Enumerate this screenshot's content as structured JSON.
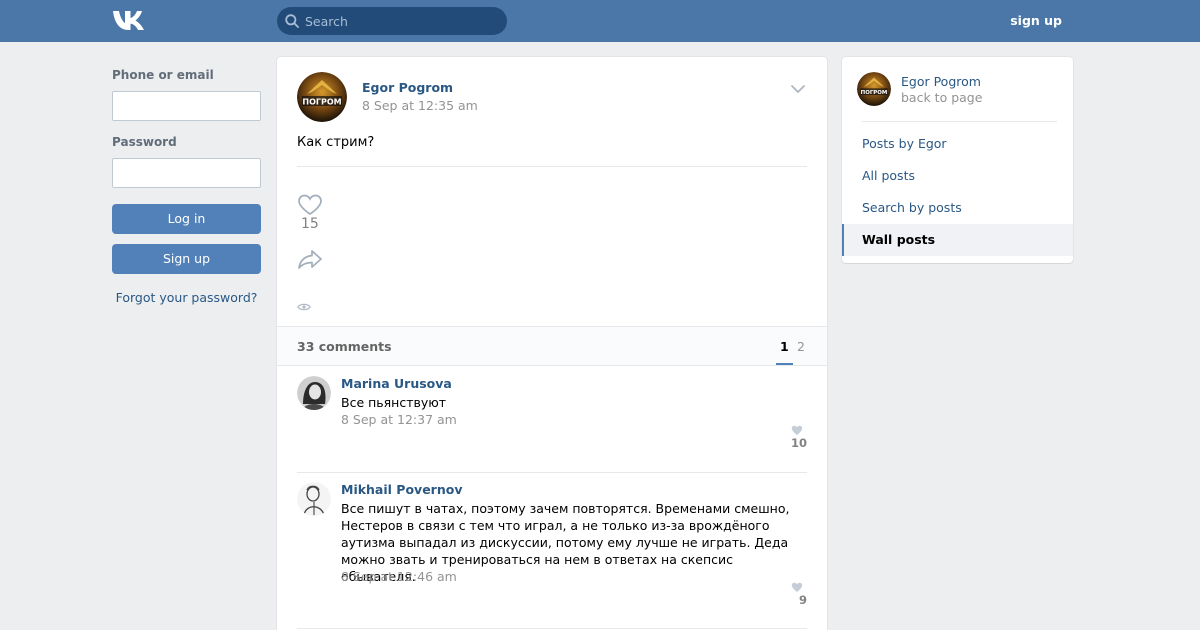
{
  "header": {
    "logo_icon": "vk-logo-icon",
    "search_placeholder": "Search",
    "signup_label": "sign up",
    "bg_color": "#4a76a8"
  },
  "login": {
    "phone_label": "Phone or email",
    "password_label": "Password",
    "login_button": "Log in",
    "signup_button": "Sign up",
    "forgot_link": "Forgot your password?"
  },
  "post": {
    "author": "Egor Pogrom",
    "avatar_text": "ПОГРОМ",
    "date": "8 Sep at 12:35 am",
    "text": "Как стрим?",
    "likes": "15",
    "like_icon": "heart-icon",
    "share_icon": "share-icon",
    "views_icon": "eye-icon"
  },
  "comments": {
    "count_label": "33 comments",
    "pages": [
      "1",
      "2"
    ],
    "current_page": "1",
    "items": [
      {
        "author": "Marina Urusova",
        "text": "Все пьянствуют",
        "date": "8 Sep at 12:37 am",
        "likes": "10"
      },
      {
        "author": "Mikhail Povernov",
        "text": "Все пишут в чатах, поэтому зачем повторятся. Временами смешно, Нестеров в связи с тем что играл, а не только из-за врождёного аутизма выпадал из дискуссии, потому ему лучше не играть. Деда можно звать и тренироваться на нем в ответах на скепсис обывателя.",
        "date": "8 Sep at 12:46 am",
        "likes": "9"
      }
    ]
  },
  "sidebar": {
    "name": "Egor Pogrom",
    "back_label": "back to page",
    "items": [
      {
        "label": "Posts by Egor",
        "active": false
      },
      {
        "label": "All posts",
        "active": false
      },
      {
        "label": "Search by posts",
        "active": false
      },
      {
        "label": "Wall posts",
        "active": true
      }
    ]
  }
}
